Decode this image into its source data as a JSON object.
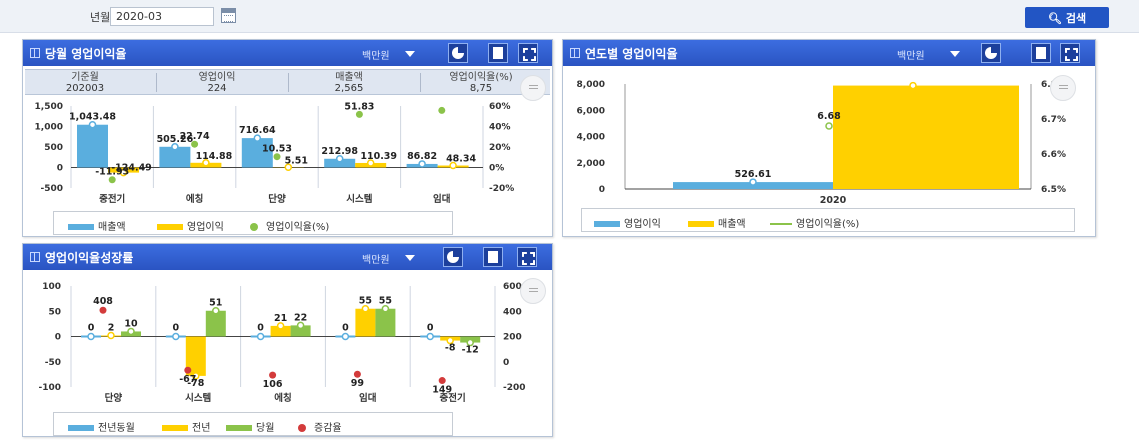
{
  "toolbar": {
    "period_label": "년월",
    "period_value": "2020-03",
    "search_label": "검색"
  },
  "colors": {
    "blue": "#5aaede",
    "yellow": "#ffd000",
    "green": "#8bc34a",
    "red": "#d33b3b",
    "header": "#2a54c2"
  },
  "icons": [
    "window-icon",
    "chevron-down-icon",
    "pie-chart-icon",
    "save-icon",
    "expand-icon",
    "calendar-icon",
    "search-icon"
  ],
  "panel1": {
    "title": "당월 영업이익율",
    "unit": "백만원",
    "summary": [
      {
        "label": "기준월",
        "value": "202003"
      },
      {
        "label": "영업이익",
        "value": "224"
      },
      {
        "label": "매출액",
        "value": "2,565"
      },
      {
        "label": "영업이익율(%)",
        "value": "8,75"
      }
    ],
    "legend": [
      "매출액",
      "영업이익",
      "영업이익율(%)"
    ]
  },
  "panel2": {
    "title": "연도별 영업이익율",
    "unit": "백만원",
    "legend": [
      "영업이익",
      "매출액",
      "영업이익율(%)"
    ]
  },
  "panel3": {
    "title": "영업이익율성장률",
    "unit": "백만원",
    "legend": [
      "전년동월",
      "전년",
      "당월",
      "증감율"
    ]
  },
  "chart_data": [
    {
      "type": "bar",
      "categories": [
        "중전기",
        "에칭",
        "단양",
        "시스템",
        "임대"
      ],
      "series": [
        {
          "name": "매출액",
          "values": [
            1043.48,
            505.26,
            716.64,
            212.98,
            86.82
          ]
        },
        {
          "name": "영업이익",
          "values": [
            -124.49,
            114.88,
            5.51,
            110.39,
            48.34
          ]
        },
        {
          "name": "영업이익율(%)",
          "values": [
            -11.93,
            22.74,
            10.53,
            51.83,
            55.68
          ]
        }
      ],
      "data_labels": [
        [
          "1,043.48",
          "505.26",
          "716.64",
          "212.98",
          "86.82"
        ],
        [
          "-124.49",
          "114.88",
          "5.51",
          "110.39",
          "48.34"
        ],
        [
          "-11.93",
          "22.74",
          "10.53",
          "51.83",
          ""
        ]
      ],
      "y_ticks": [
        "1,500",
        "1,000",
        "500",
        "0",
        "-500"
      ],
      "y2_ticks": [
        "60%",
        "40%",
        "20%",
        "0%",
        "-20%"
      ],
      "ylim": [
        -500,
        1500
      ],
      "y2lim": [
        -20,
        60
      ]
    },
    {
      "type": "bar",
      "categories": [
        "2020"
      ],
      "series": [
        {
          "name": "영업이익",
          "values": [
            526.61
          ]
        },
        {
          "name": "매출액",
          "values": [
            7880
          ]
        },
        {
          "name": "영업이익율(%)",
          "values": [
            6.68
          ]
        }
      ],
      "data_labels": [
        "526.61",
        "6.68"
      ],
      "y_ticks": [
        "8,000",
        "6,000",
        "4,000",
        "2,000",
        "0"
      ],
      "y2_ticks": [
        "6.8%",
        "6.7%",
        "6.6%",
        "6.5%"
      ],
      "ylim": [
        0,
        8000
      ],
      "y2lim": [
        6.5,
        6.8
      ]
    },
    {
      "type": "bar",
      "categories": [
        "단양",
        "시스템",
        "에칭",
        "임대",
        "중전기"
      ],
      "series": [
        {
          "name": "전년동월",
          "values": [
            0,
            0,
            0,
            0,
            0
          ]
        },
        {
          "name": "전년",
          "values": [
            2,
            -78,
            21,
            55,
            -8
          ]
        },
        {
          "name": "당월",
          "values": [
            10,
            51,
            22,
            55,
            -12
          ]
        },
        {
          "name": "증감율",
          "values": [
            408,
            -67,
            -106,
            -99,
            -149
          ]
        }
      ],
      "data_labels": [
        [
          "0",
          "0",
          "0",
          "0",
          "0"
        ],
        [
          "2",
          "-78",
          "21",
          "55",
          "-8"
        ],
        [
          "10",
          "51",
          "22",
          "55",
          "-12"
        ],
        [
          "408",
          "-67",
          "106",
          "99",
          "149"
        ]
      ],
      "y_ticks": [
        "100",
        "50",
        "0",
        "-50",
        "-100"
      ],
      "y2_ticks": [
        "600",
        "400",
        "200",
        "0",
        "-200"
      ],
      "ylim": [
        -100,
        100
      ],
      "y2lim": [
        -200,
        600
      ]
    }
  ]
}
